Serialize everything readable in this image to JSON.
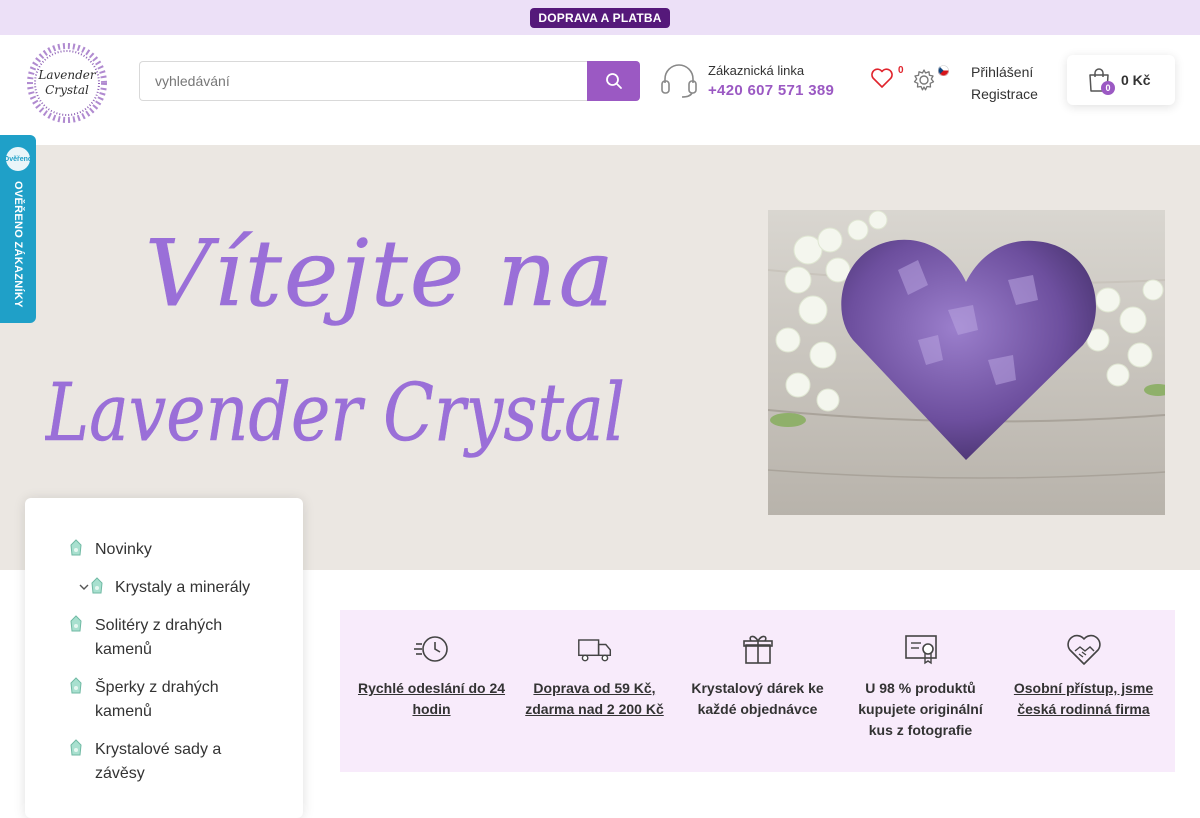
{
  "topbar": {
    "badge": "DOPRAVA A PLATBA"
  },
  "header": {
    "logo_text": "Lavender Crystal",
    "search": {
      "placeholder": "vyhledávání",
      "value": ""
    },
    "hotline": {
      "title": "Zákaznická linka",
      "phone": "+420 607 571 389"
    },
    "wishlist": {
      "count": "0"
    },
    "account": {
      "login": "Přihlášení",
      "register": "Registrace"
    },
    "cart": {
      "count": "0",
      "total": "0 Kč"
    }
  },
  "verified_tab": {
    "label": "OVĚŘENO ZÁKAZNÍKY",
    "badge": "Ověřeno"
  },
  "hero": {
    "line1": "Vítejte na",
    "line2": "Lavender Crystal"
  },
  "categories": [
    {
      "label": "Novinky",
      "expandable": false
    },
    {
      "label": "Krystaly a minerály",
      "expandable": true
    },
    {
      "label": "Solitéry z drahých kamenů",
      "expandable": false
    },
    {
      "label": "Šperky z drahých kamenů",
      "expandable": false
    },
    {
      "label": "Krystalové sady a závěsy",
      "expandable": false
    }
  ],
  "features": [
    {
      "icon": "fast-clock-icon",
      "text": "Rychlé odeslání do 24 hodin",
      "link": true
    },
    {
      "icon": "delivery-truck-icon",
      "text": "Doprava od 59 Kč, zdarma nad 2 200 Kč",
      "link": true
    },
    {
      "icon": "gift-icon",
      "text": "Krystalový dárek ke každé objednávce",
      "link": false
    },
    {
      "icon": "certificate-icon",
      "text": "U 98 % produktů kupujete originální kus z fotografie",
      "link": false
    },
    {
      "icon": "handshake-heart-icon",
      "text": "Osobní přístup, jsme česká rodinná firma",
      "link": true
    }
  ],
  "colors": {
    "brand": "#9b59c3",
    "topbar_bg": "#ece0f7",
    "badge_bg": "#55197a",
    "features_bg": "#f8ebfb",
    "verified_bg": "#1fa0c8"
  }
}
